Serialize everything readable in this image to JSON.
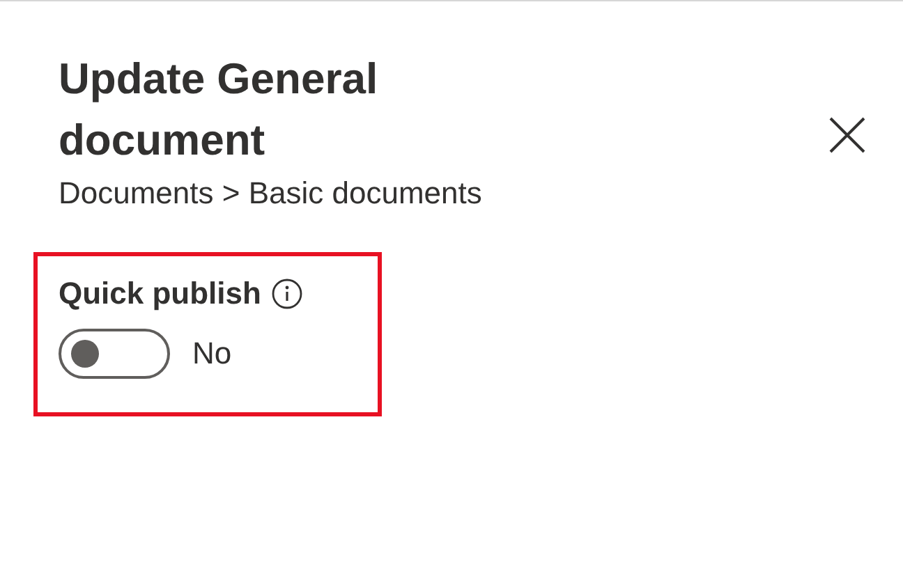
{
  "panel": {
    "title": "Update General document",
    "breadcrumb": "Documents > Basic documents"
  },
  "field": {
    "label": "Quick publish",
    "highlighted": true,
    "toggle": {
      "on": false,
      "state_label": "No"
    }
  }
}
